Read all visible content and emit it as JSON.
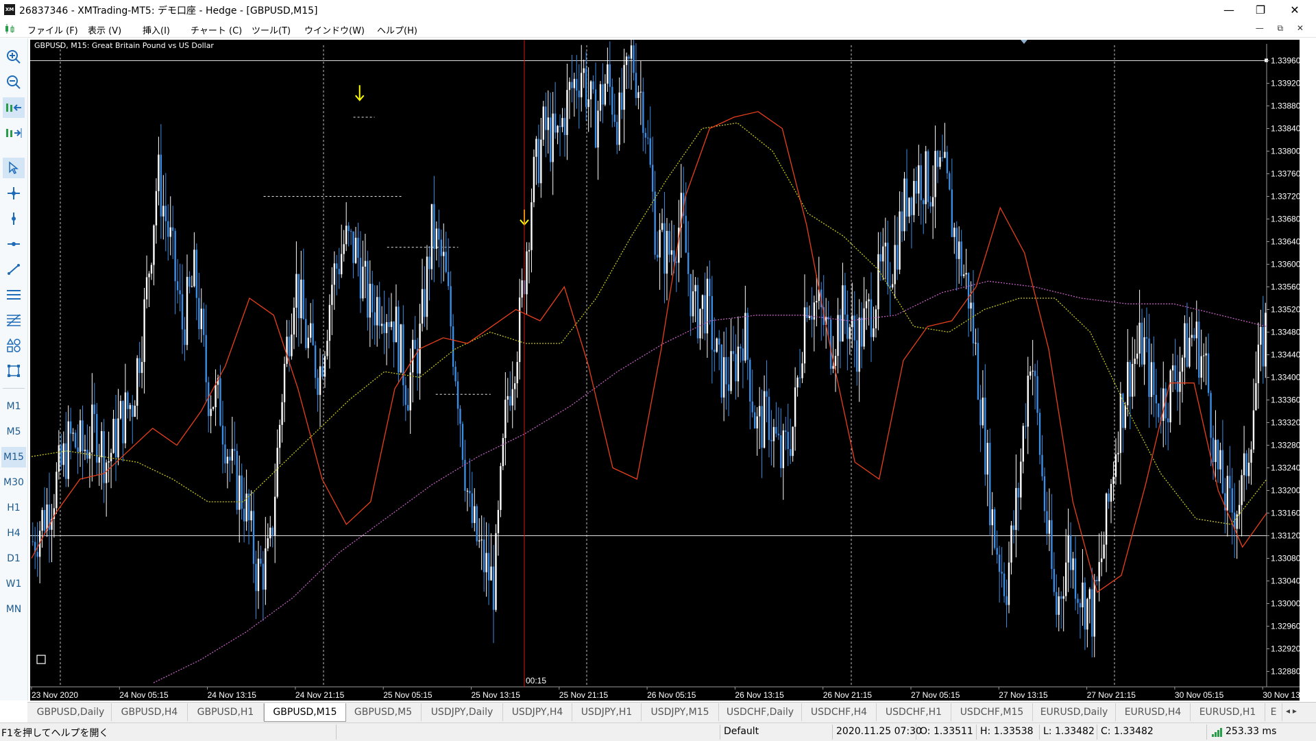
{
  "window": {
    "title": "26837346 - XMTrading-MT5: デモ口座 - Hedge - [GBPUSD,M15]",
    "app_icon": "XM",
    "minimize": "—",
    "restore": "❐",
    "close": "✕"
  },
  "menu": [
    "ファイル (F)",
    "表示 (V)",
    "挿入(I)",
    "チャート (C)",
    "ツール(T)",
    "ウインドウ(W)",
    "ヘルプ(H)"
  ],
  "mdi_controls": "— ⧉ ✕",
  "timeframes": [
    "M1",
    "M5",
    "M15",
    "M30",
    "H1",
    "H4",
    "D1",
    "W1",
    "MN"
  ],
  "active_timeframe": "M15",
  "tool_icons": [
    "zoom-in-icon",
    "zoom-out-icon",
    "scroll-chart-icon",
    "chart-shift-icon",
    "cursor-icon",
    "crosshair-icon",
    "vertical-line-icon",
    "horizontal-line-icon",
    "trendline-icon",
    "channel-icon",
    "fibonacci-icon",
    "shapes-icon",
    "object-list-icon"
  ],
  "chart": {
    "label": "GBPUSD, M15:  Great Britain Pound vs US Dollar",
    "price_labels": [
      "1.33960",
      "1.33920",
      "1.33880",
      "1.33840",
      "1.33800",
      "1.33760",
      "1.33720",
      "1.33680",
      "1.33640",
      "1.33600",
      "1.33560",
      "1.33520",
      "1.33480",
      "1.33440",
      "1.33400",
      "1.33360",
      "1.33320",
      "1.33280",
      "1.33240",
      "1.33200",
      "1.33160",
      "1.33120",
      "1.33080",
      "1.33040",
      "1.33000",
      "1.32960",
      "1.32920",
      "1.32880"
    ],
    "time_labels": [
      "23 Nov 2020",
      "24 Nov 05:15",
      "24 Nov 13:15",
      "24 Nov 21:15",
      "25 Nov 05:15",
      "25 Nov 13:15",
      "25 Nov 21:15",
      "26 Nov 05:15",
      "26 Nov 13:15",
      "26 Nov 21:15",
      "27 Nov 05:15",
      "27 Nov 13:15",
      "27 Nov 21:15",
      "30 Nov 05:15",
      "30 Nov 13:15"
    ],
    "countdown": "00:15",
    "colors": {
      "background": "#000000",
      "candle_up": "#ffffff",
      "candle_down": "#3a8ee6",
      "ma_fast": "#e8401c",
      "ma_mid": "#c8c81e",
      "ma_slow": "#c060c0",
      "arrow": "#ffff00",
      "current_time_line": "#d01818",
      "axis_text": "#ffffff"
    }
  },
  "chart_data": {
    "type": "candlestick",
    "symbol": "GBPUSD",
    "timeframe": "M15",
    "ylim": [
      1.3286,
      1.3398
    ],
    "close_path": [
      1.3311,
      1.3316,
      1.3322,
      1.3329,
      1.3327,
      1.3331,
      1.3325,
      1.3332,
      1.3336,
      1.3352,
      1.3376,
      1.3364,
      1.3349,
      1.3358,
      1.3338,
      1.3335,
      1.3323,
      1.3318,
      1.3305,
      1.3308,
      1.3338,
      1.3358,
      1.3346,
      1.3341,
      1.3357,
      1.3364,
      1.3362,
      1.3352,
      1.3354,
      1.335,
      1.3338,
      1.3346,
      1.3366,
      1.3359,
      1.334,
      1.3316,
      1.3308,
      1.3303,
      1.3336,
      1.3349,
      1.3373,
      1.3384,
      1.3381,
      1.339,
      1.3395,
      1.3385,
      1.3393,
      1.3385,
      1.3397,
      1.3388,
      1.3364,
      1.3362,
      1.3368,
      1.3351,
      1.3353,
      1.3341,
      1.334,
      1.3349,
      1.3331,
      1.3333,
      1.3325,
      1.3332,
      1.3355,
      1.3352,
      1.3346,
      1.3352,
      1.3346,
      1.3351,
      1.3358,
      1.3361,
      1.3372,
      1.3376,
      1.3374,
      1.3376,
      1.3364,
      1.3355,
      1.3336,
      1.3313,
      1.3303,
      1.332,
      1.3346,
      1.332,
      1.3298,
      1.331,
      1.3302,
      1.3298,
      1.3313,
      1.3332,
      1.3342,
      1.3346,
      1.3335,
      1.3337,
      1.3343,
      1.3348,
      1.3342,
      1.3323,
      1.3316,
      1.332,
      1.3338,
      1.3351
    ],
    "ma_fast": [
      1.3308,
      1.3316,
      1.3322,
      1.3323,
      1.3327,
      1.3331,
      1.3328,
      1.3334,
      1.3342,
      1.3354,
      1.3351,
      1.3338,
      1.3322,
      1.3314,
      1.3318,
      1.3338,
      1.3345,
      1.3347,
      1.3346,
      1.3349,
      1.3352,
      1.335,
      1.3356,
      1.3342,
      1.3324,
      1.3322,
      1.3345,
      1.3372,
      1.3384,
      1.3386,
      1.3387,
      1.3384,
      1.3367,
      1.3345,
      1.3325,
      1.3322,
      1.3343,
      1.3349,
      1.335,
      1.3356,
      1.337,
      1.3362,
      1.3345,
      1.3318,
      1.3302,
      1.3305,
      1.3321,
      1.3339,
      1.3339,
      1.332,
      1.331,
      1.3316
    ],
    "ma_mid": [
      1.3326,
      1.3327,
      1.3326,
      1.3325,
      1.3322,
      1.3318,
      1.3318,
      1.3324,
      1.333,
      1.3336,
      1.3341,
      1.334,
      1.3345,
      1.3348,
      1.3346,
      1.3346,
      1.3354,
      1.3365,
      1.3375,
      1.3384,
      1.3385,
      1.338,
      1.3369,
      1.3365,
      1.3359,
      1.3349,
      1.3348,
      1.3352,
      1.3354,
      1.3354,
      1.3348,
      1.3335,
      1.3323,
      1.3315,
      1.3314,
      1.3322
    ],
    "ma_slow": [
      1.3286,
      1.329,
      1.3295,
      1.3301,
      1.3309,
      1.3315,
      1.3321,
      1.3326,
      1.333,
      1.3335,
      1.3341,
      1.3346,
      1.335,
      1.3351,
      1.3351,
      1.335,
      1.3351,
      1.3355,
      1.3357,
      1.3356,
      1.3354,
      1.3353,
      1.3353,
      1.3351,
      1.3349
    ],
    "horizontal_lines": [
      1.3312,
      1.3396
    ],
    "dotted_levels": [
      [
        1.3386,
        25.8,
        27.5
      ],
      [
        1.3372,
        18.6,
        29.8
      ],
      [
        1.3363,
        28.5,
        34.2
      ],
      [
        1.3337,
        32.4,
        36.8
      ]
    ],
    "arrows": [
      1.3389,
      1.3367
    ]
  },
  "tabs": [
    "GBPUSD,Daily",
    "GBPUSD,H4",
    "GBPUSD,H1",
    "GBPUSD,M15",
    "GBPUSD,M5",
    "USDJPY,Daily",
    "USDJPY,H4",
    "USDJPY,H1",
    "USDJPY,M15",
    "USDCHF,Daily",
    "USDCHF,H4",
    "USDCHF,H1",
    "USDCHF,M15",
    "EURUSD,Daily",
    "EURUSD,H4",
    "EURUSD,H1",
    "E"
  ],
  "active_tab": "GBPUSD,M15",
  "tab_scroll": "◂ ▸",
  "status": {
    "help": "F1を押してヘルプを開く",
    "profile": "Default",
    "datetime": "2020.11.25 07:30",
    "open": "O: 1.33511",
    "high": "H: 1.33538",
    "low": "L: 1.33482",
    "close": "C: 1.33482",
    "ping": "253.33 ms"
  }
}
